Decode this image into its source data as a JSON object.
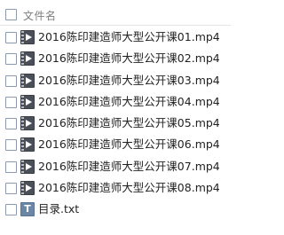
{
  "header": {
    "column_label": "文件名"
  },
  "files": [
    {
      "name": "2016陈印建造师大型公开课01.mp4",
      "icon": "video-file-icon"
    },
    {
      "name": "2016陈印建造师大型公开课02.mp4",
      "icon": "video-file-icon"
    },
    {
      "name": "2016陈印建造师大型公开课03.mp4",
      "icon": "video-file-icon"
    },
    {
      "name": "2016陈印建造师大型公开课04.mp4",
      "icon": "video-file-icon"
    },
    {
      "name": "2016陈印建造师大型公开课05.mp4",
      "icon": "video-file-icon"
    },
    {
      "name": "2016陈印建造师大型公开课06.mp4",
      "icon": "video-file-icon"
    },
    {
      "name": "2016陈印建造师大型公开课07.mp4",
      "icon": "video-file-icon"
    },
    {
      "name": "2016陈印建造师大型公开课08.mp4",
      "icon": "video-file-icon"
    },
    {
      "name": "目录.txt",
      "icon": "text-file-icon",
      "icon_glyph": "T"
    }
  ]
}
